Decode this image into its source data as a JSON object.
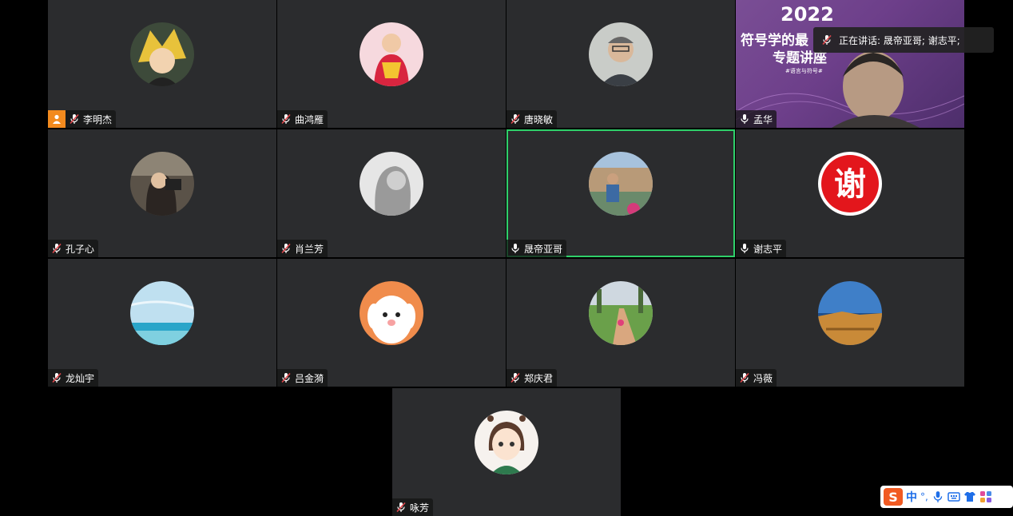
{
  "meeting": {
    "speaker_banner": "正在讲话: 晟帝亚哥; 谢志平;",
    "shared_screen": {
      "year": "2022",
      "title_line1": "符号学的最",
      "title_line2": "专题讲座",
      "subtitle": "#语言与符号#"
    },
    "participants": [
      {
        "name": "李明杰",
        "host": true,
        "muted": true
      },
      {
        "name": "曲鸿雁",
        "muted": true
      },
      {
        "name": "唐晓敏",
        "muted": true
      },
      {
        "name": "孟华",
        "muted": false,
        "sharing": true
      },
      {
        "name": "孔子心",
        "muted": true
      },
      {
        "name": "肖兰芳",
        "muted": true
      },
      {
        "name": "晟帝亚哥",
        "muted": false,
        "speaking": true
      },
      {
        "name": "谢志平",
        "muted": false
      },
      {
        "name": "龙灿宇",
        "muted": true
      },
      {
        "name": "吕金漪",
        "muted": true
      },
      {
        "name": "郑庆君",
        "muted": true
      },
      {
        "name": "冯薇",
        "muted": true
      },
      {
        "name": "咏芳",
        "muted": true
      }
    ],
    "xie_avatar_char": "谢"
  },
  "ime_toolbar": {
    "logo": "S",
    "mode": "中",
    "punct": "°,",
    "icons": [
      "mic-icon",
      "keyboard-icon",
      "shirt-icon",
      "apps-icon"
    ]
  },
  "colors": {
    "tile_bg": "#2b2c2e",
    "speaking_border": "#2fd06a",
    "host_badge": "#f28a1e",
    "muted_mic": "#e0474c"
  }
}
